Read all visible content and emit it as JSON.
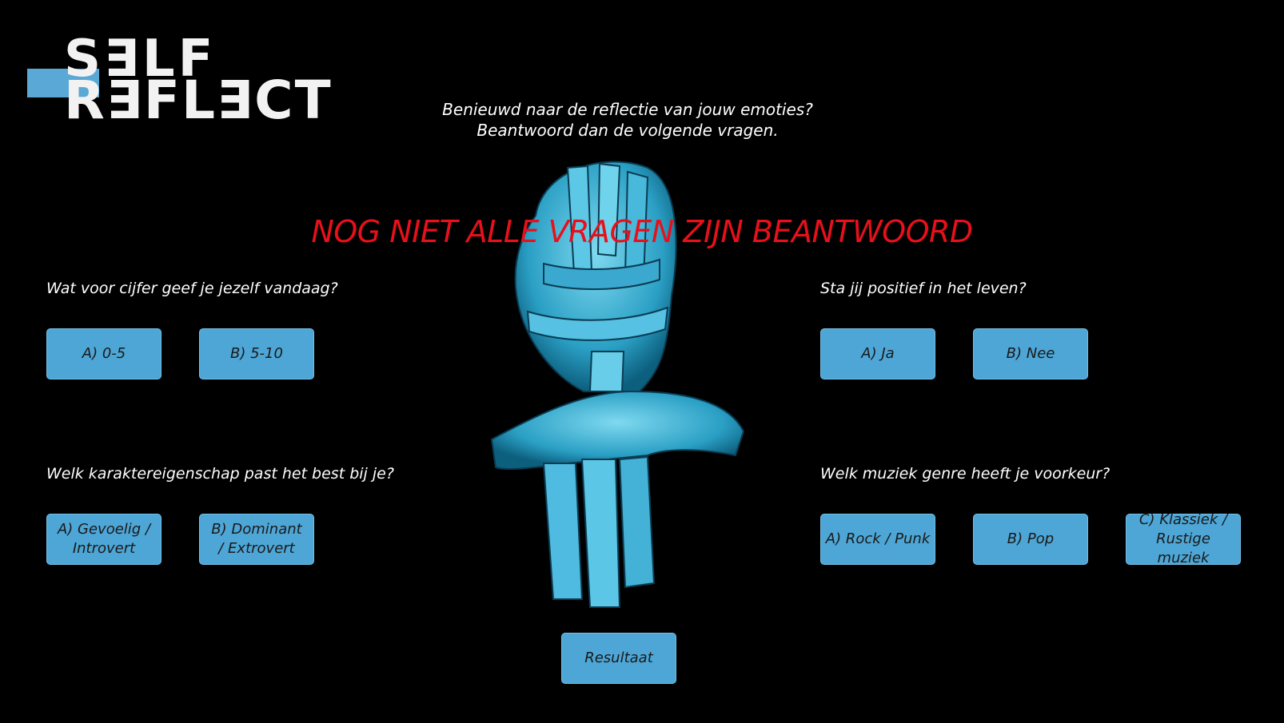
{
  "logo": {
    "line1": "S∃LF",
    "line2": "R∃FL∃CT"
  },
  "intro": {
    "line1": "Benieuwd naar de reflectie van jouw emoties?",
    "line2": "Beantwoord dan de volgende vragen."
  },
  "warning": "NOG NIET ALLE VRAGEN ZIJN BEANTWOORD",
  "questions": [
    {
      "text": "Wat voor cijfer geef je jezelf vandaag?",
      "options": [
        "A) 0-5",
        "B) 5-10"
      ]
    },
    {
      "text": "Sta jij positief in het leven?",
      "options": [
        "A) Ja",
        "B) Nee"
      ]
    },
    {
      "text": "Welk karaktereigenschap past het best bij je?",
      "options": [
        "A) Gevoelig / Introvert",
        "B) Dominant / Extrovert"
      ]
    },
    {
      "text": "Welk muziek genre heeft je voorkeur?",
      "options": [
        "A) Rock / Punk",
        "B) Pop",
        "C) Klassiek / Rustige muziek"
      ]
    }
  ],
  "result_label": "Resultaat",
  "colors": {
    "accent": "#4da6d6",
    "warning": "#e8101a",
    "background": "#000000"
  }
}
